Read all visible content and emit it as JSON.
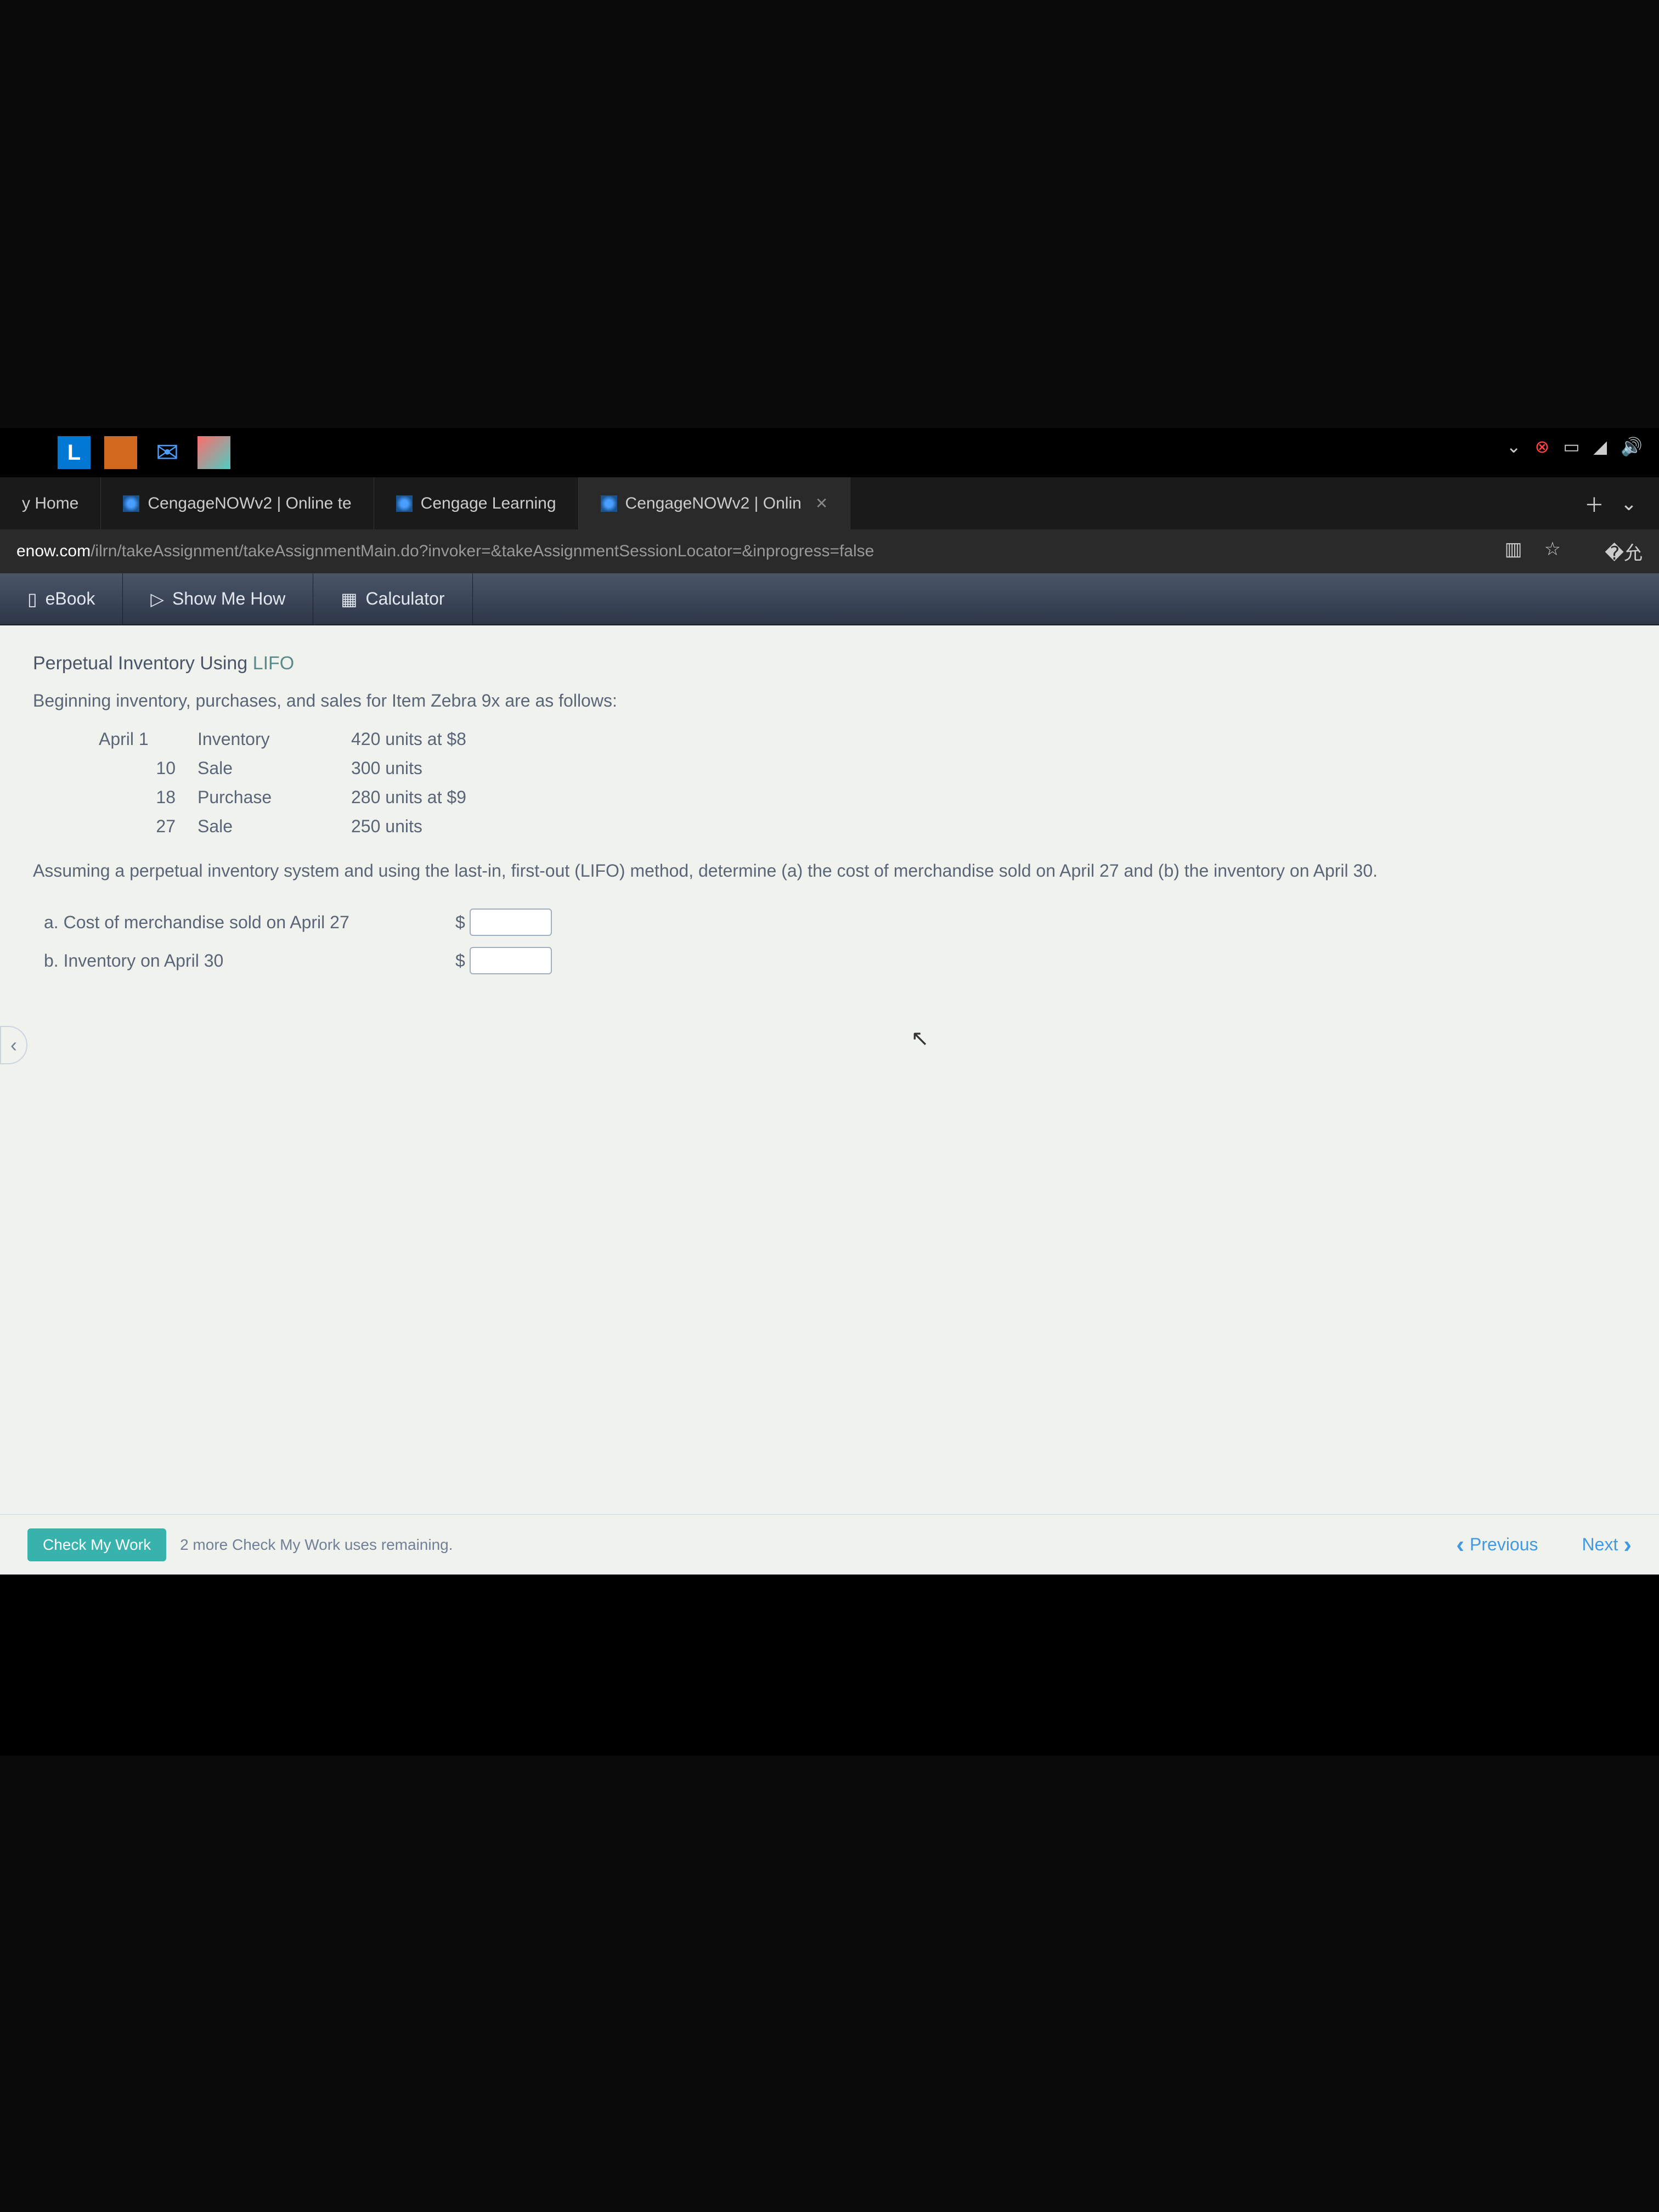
{
  "tabs": {
    "home": "y Home",
    "t1": "CengageNOWv2 | Online te",
    "t2": "Cengage Learning",
    "t3": "CengageNOWv2 | Onlin",
    "close": "✕",
    "plus": "＋",
    "chev": "⌄"
  },
  "url": {
    "domain": "enow.com",
    "path": "/ilrn/takeAssignment/takeAssignmentMain.do?invoker=&takeAssignmentSessionLocator=&inprogress=false"
  },
  "toolbar": {
    "ebook": "eBook",
    "show": "Show Me How",
    "calc": "Calculator"
  },
  "content": {
    "title_prefix": "Perpetual Inventory Using ",
    "title_lifo": "LIFO",
    "intro": "Beginning inventory, purchases, and sales for Item Zebra 9x are as follows:",
    "rows": [
      {
        "date": "April 1",
        "type": "Inventory",
        "qty": "420 units at $8"
      },
      {
        "date": "10",
        "type": "Sale",
        "qty": "300 units"
      },
      {
        "date": "18",
        "type": "Purchase",
        "qty": "280 units at $9"
      },
      {
        "date": "27",
        "type": "Sale",
        "qty": "250 units"
      }
    ],
    "question": "Assuming a perpetual inventory system and using the last-in, first-out (LIFO) method, determine (a) the cost of merchandise sold on April 27 and (b) the inventory on April 30.",
    "a_label": "a. Cost of merchandise sold on April 27",
    "b_label": "b. Inventory on April 30",
    "dollar": "$"
  },
  "footer": {
    "check": "Check My Work",
    "remaining": "2 more Check My Work uses remaining.",
    "prev": "Previous",
    "next": "Next"
  }
}
